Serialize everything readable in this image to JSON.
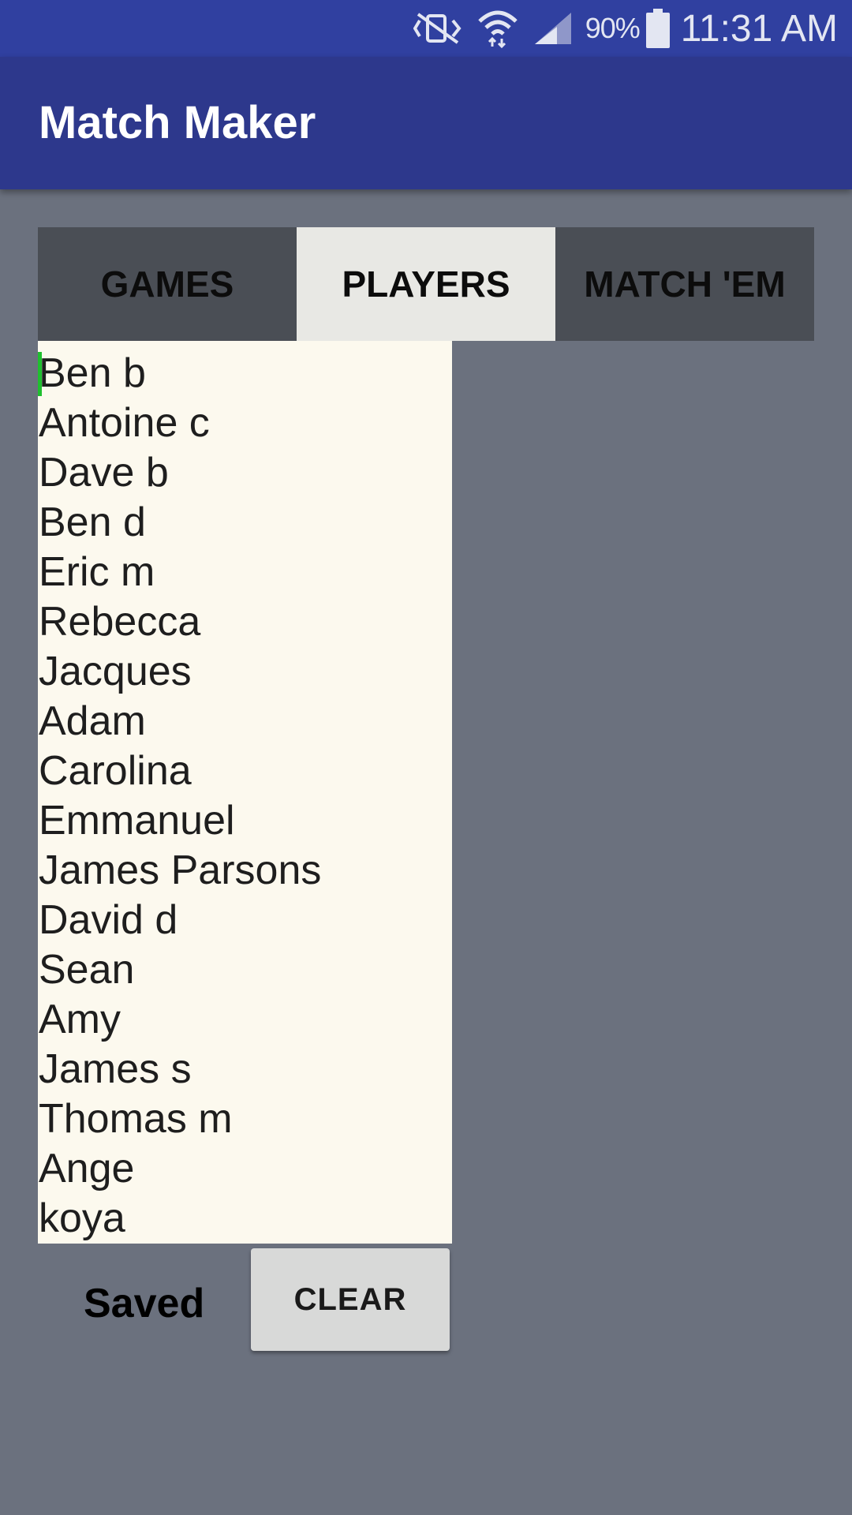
{
  "status_bar": {
    "icons": [
      "mute-vibrate-icon",
      "wifi-icon",
      "cell-signal-icon",
      "battery-icon"
    ],
    "battery": "90%",
    "time": "11:31 AM"
  },
  "app_bar": {
    "title": "Match Maker"
  },
  "tabs": [
    {
      "label": "GAMES",
      "active": false
    },
    {
      "label": "PLAYERS",
      "active": true
    },
    {
      "label": "MATCH 'EM",
      "active": false
    }
  ],
  "players": [
    "Ben b",
    "Antoine c",
    "Dave b",
    "Ben d",
    "Eric m",
    "Rebecca",
    "Jacques",
    "Adam",
    "Carolina",
    "Emmanuel",
    "James Parsons",
    "David d",
    "Sean",
    "Amy",
    "James s",
    "Thomas m",
    "Ange",
    "koya"
  ],
  "footer": {
    "status_label": "Saved",
    "clear_label": "CLEAR"
  },
  "colors": {
    "status_bar": "#3040a0",
    "app_bar": "#2d388c",
    "background": "#6b717e",
    "tab_inactive": "#4a4e55",
    "tab_active": "#e8e8e4",
    "list_background": "#fcf9ee",
    "cursor": "#1fbf2f"
  }
}
